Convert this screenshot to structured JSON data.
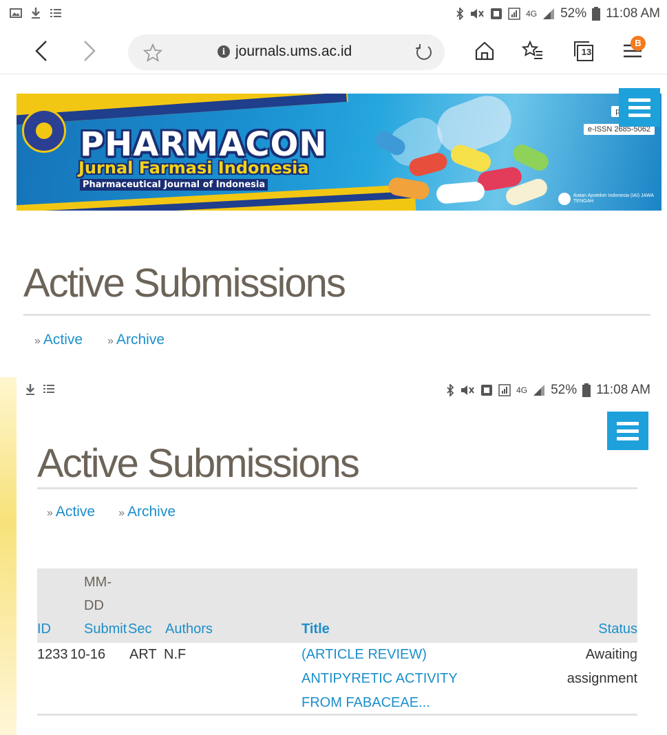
{
  "status_bar": {
    "battery": "52%",
    "time": "11:08 AM",
    "network": "4G"
  },
  "browser": {
    "url": "journals.ums.ac.id",
    "tab_count": "13",
    "menu_badge": "B"
  },
  "banner": {
    "title": "PHARMACON",
    "subtitle": "Jurnal Farmasi Indonesia",
    "tagline": "Pharmaceutical Journal of Indonesia",
    "issn_print": "p-ISSN 14",
    "issn_online": "e-ISSN 2685-5062",
    "iai_text": "Ikatan Apoteker Indonesia (IAI) JAWA TENGAH"
  },
  "page": {
    "title": "Active Submissions",
    "nav_active": "Active",
    "nav_archive": "Archive",
    "nav_marker": "»"
  },
  "table": {
    "headers": {
      "id": "ID",
      "date_top": "MM-",
      "date_mid": "DD",
      "submit": "Submit",
      "sec": "Sec",
      "authors": "Authors",
      "title": "Title",
      "status": "Status"
    },
    "rows": [
      {
        "id": "1233",
        "date": "10-16",
        "sec": "ART",
        "authors": "N.F",
        "title_line1": "(ARTICLE REVIEW)",
        "title_line2": "ANTIPYRETIC ACTIVITY",
        "title_line3": "FROM FABACEAE...",
        "status_line1": "Awaiting",
        "status_line2": "assignment"
      }
    ]
  },
  "colors": {
    "link": "#1b8fcb",
    "heading": "#6d6459",
    "menu_button": "#1ea1db",
    "badge": "#f47b20"
  }
}
